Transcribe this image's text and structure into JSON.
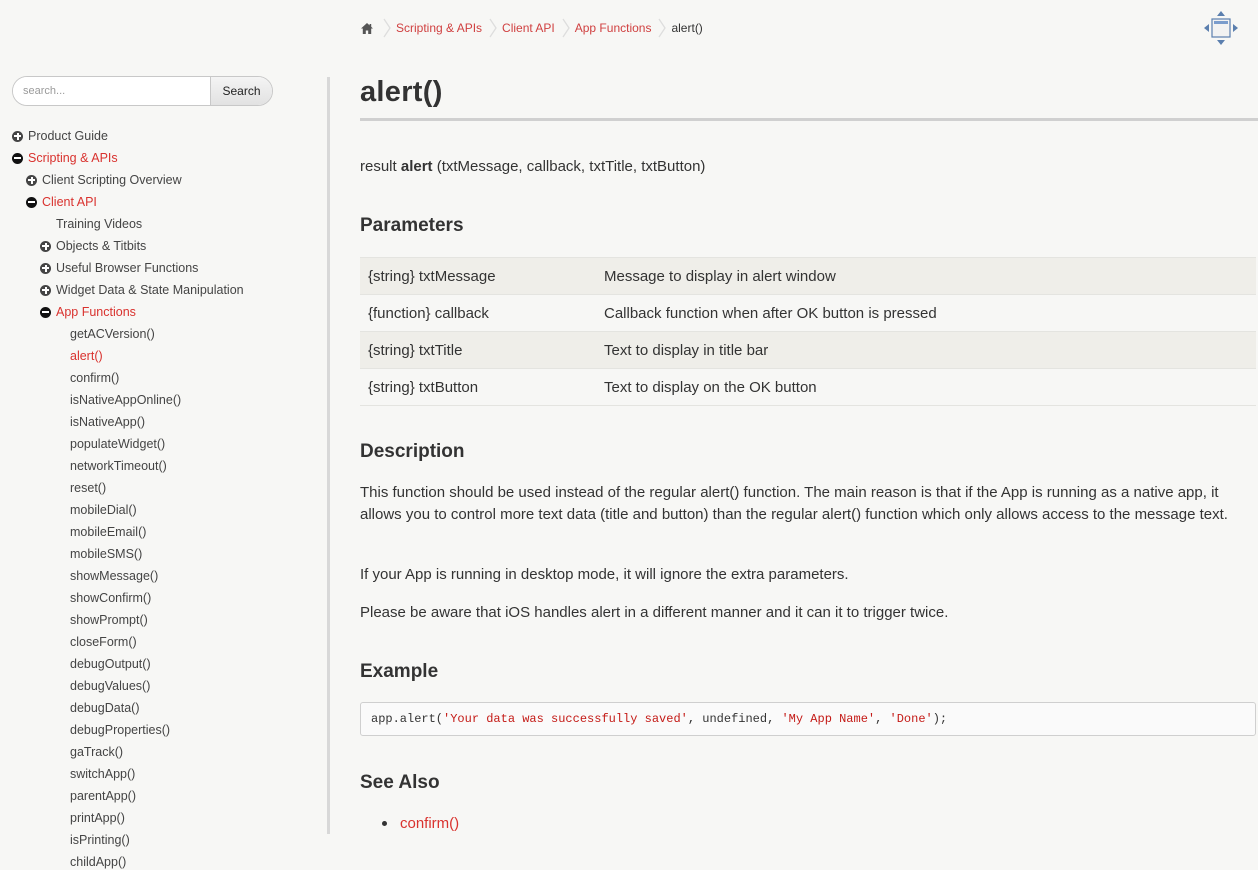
{
  "breadcrumb": {
    "home_icon": "home-icon",
    "items": [
      "Scripting & APIs",
      "Client API",
      "App Functions"
    ],
    "current": "alert()"
  },
  "toolbar": {
    "expand_icon": "expand-arrows-icon"
  },
  "search": {
    "placeholder": "search...",
    "button_label": "Search"
  },
  "nav": {
    "product_guide": "Product Guide",
    "scripting_apis": "Scripting & APIs",
    "client_scripting_overview": "Client Scripting Overview",
    "client_api": "Client API",
    "training_videos": "Training Videos",
    "objects_titbits": "Objects & Titbits",
    "useful_browser_functions": "Useful Browser Functions",
    "widget_data": "Widget Data & State Manipulation",
    "app_functions": "App Functions",
    "functions": [
      "getACVersion()",
      "alert()",
      "confirm()",
      "isNativeAppOnline()",
      "isNativeApp()",
      "populateWidget()",
      "networkTimeout()",
      "reset()",
      "mobileDial()",
      "mobileEmail()",
      "mobileSMS()",
      "showMessage()",
      "showConfirm()",
      "showPrompt()",
      "closeForm()",
      "debugOutput()",
      "debugValues()",
      "debugData()",
      "debugProperties()",
      "gaTrack()",
      "switchApp()",
      "parentApp()",
      "printApp()",
      "isPrinting()",
      "childApp()"
    ],
    "active_function": "alert()"
  },
  "page": {
    "title": "alert()",
    "signature": {
      "prefix": "result ",
      "name": "alert",
      "params": " (txtMessage, callback, txtTitle, txtButton)"
    },
    "parameters_heading": "Parameters",
    "parameters": [
      {
        "name": "{string} txtMessage",
        "description": "Message to display in alert window"
      },
      {
        "name": "{function} callback",
        "description": "Callback function when after OK button is pressed"
      },
      {
        "name": "{string} txtTitle",
        "description": "Text to display in title bar"
      },
      {
        "name": "{string} txtButton",
        "description": "Text to display on the OK button"
      }
    ],
    "description_heading": "Description",
    "description": [
      "This function should be used instead of the regular alert() function. The main reason is that if the App is running as a native app, it allows you to control more text data (title and button) than the regular alert() function which only allows access to the message text.",
      "If your App is running in desktop mode, it will ignore the extra parameters.",
      "Please be aware that iOS handles alert in a different manner and it can it to trigger twice."
    ],
    "example_heading": "Example",
    "example_code": {
      "p1": "app.alert(",
      "s1": "'Your data was successfully saved'",
      "p2": ", undefined, ",
      "s2": "'My App Name'",
      "p3": ", ",
      "s3": "'Done'",
      "p4": ");"
    },
    "see_also_heading": "See Also",
    "see_also": [
      "confirm()"
    ]
  },
  "colors": {
    "accent": "#d9322e",
    "background": "#f7f7f5",
    "table_shade": "#efeee9",
    "code_string": "#c41a16"
  }
}
